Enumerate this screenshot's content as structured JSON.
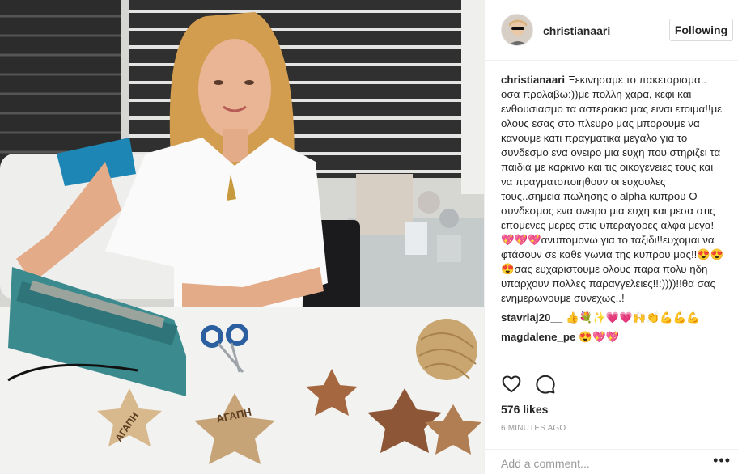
{
  "post": {
    "username": "christianaari",
    "follow_label": "Following",
    "avatar_icon": "profile-photo",
    "caption": "Ξεκινησαμε το πακεταρισμα.. οσα προλαβω:))με πολλη χαρα, κεφι και ενθουσιασμο τα αστερακια μας ειναι ετοιμα!!με ολους εσας στο πλευρο μας μπορουμε να κανουμε κατι πραγματικα μεγαλο για το συνδεσμο ενα ονειρο μια ευχη που στηριζει τα παιδια με καρκινο και τις οικογενειες τους και να πραγματοποιηθουν οι ευχουλες τους..σημεια πωλησης ο alpha κυπρου Ο συνδεσμος ενα ονειρο μια ευχη και μεσα στις επομενες μερες στις υπεραγορες αλφα μεγα!💖💖💖ανυπομονω για το ταξιδι!!ευχομαι να φτάσουν σε καθε γωνια της κυπρου μας!!😍😍😍σας ευχαριστουμε ολους παρα πολυ ηδη υπαρχουν πολλες παραγγελειες!!:))))!!θα σας ενημερωνουμε συνεχως..!",
    "comments": [
      {
        "author": "stavriaj20__",
        "text": "👍💐✨💗💗🙌👏💪💪💪"
      },
      {
        "author": "magdalene_pe",
        "text": "😍💖💖"
      }
    ],
    "likes": "576 likes",
    "timestamp": "6 MINUTES AGO",
    "comment_placeholder": "Add a comment...",
    "more_label": "•••",
    "icons": {
      "like": "heart-icon",
      "comment": "speech-bubble-icon"
    },
    "photo_text": {
      "star_label_1": "ΑΓΑΠΗ",
      "star_label_2": "ΑΓΑΠΗ"
    }
  }
}
